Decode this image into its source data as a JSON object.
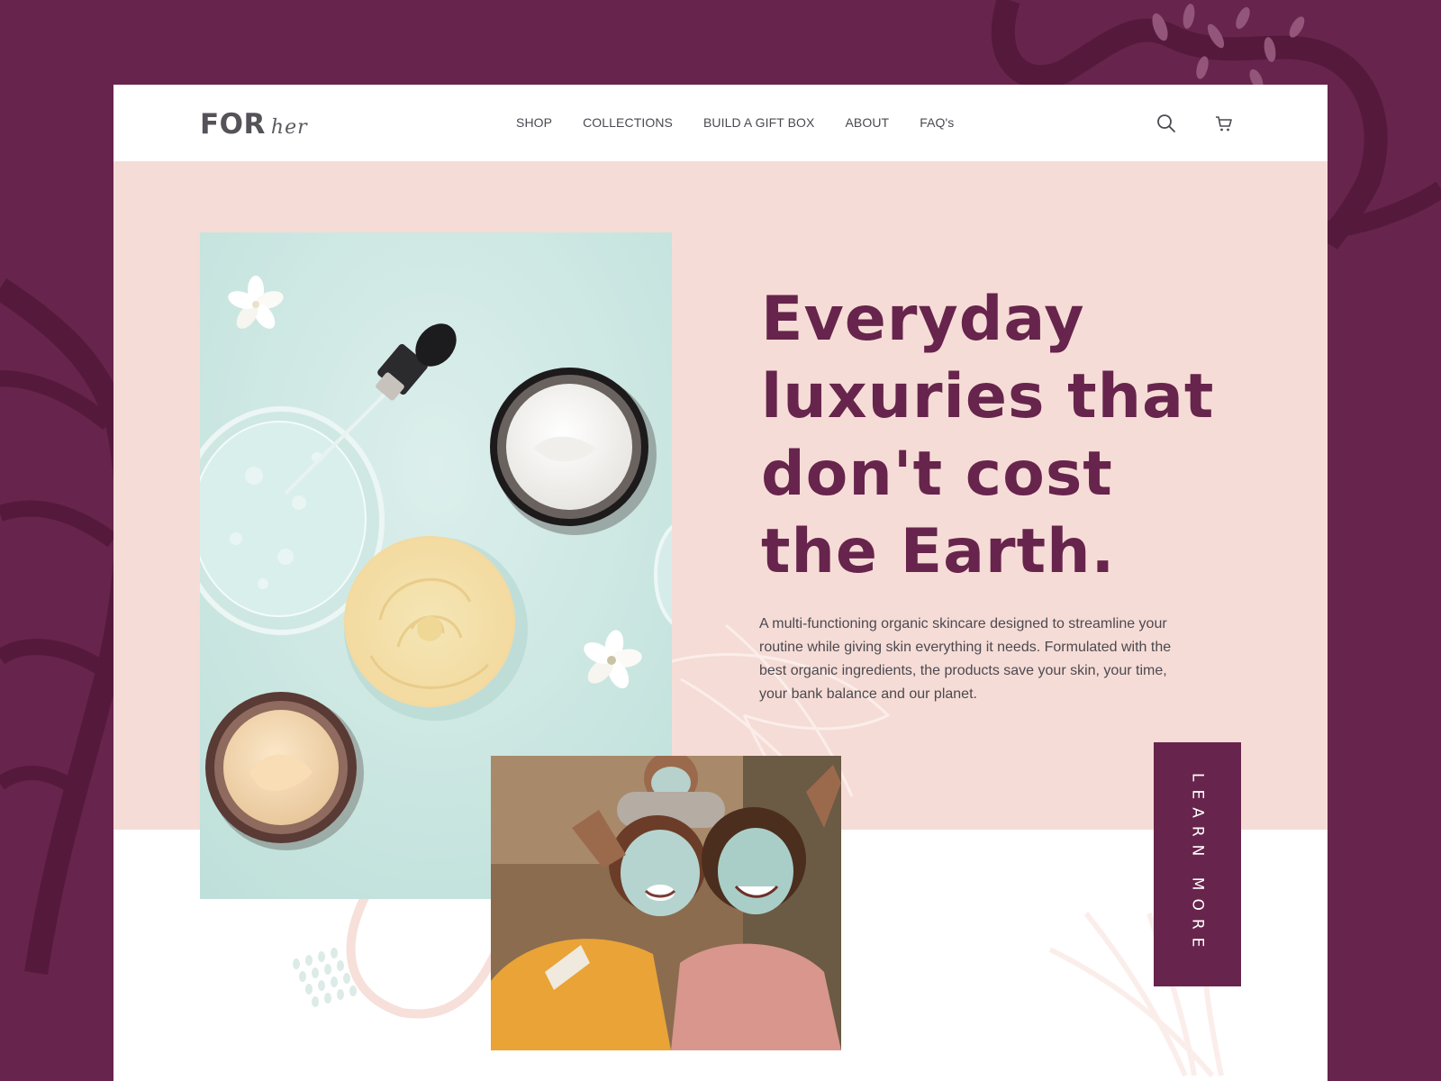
{
  "brand": {
    "logo_main": "FOR",
    "logo_script": "her"
  },
  "nav": {
    "items": [
      {
        "label": "SHOP"
      },
      {
        "label": "COLLECTIONS"
      },
      {
        "label": "BUILD A GIFT BOX"
      },
      {
        "label": "ABOUT"
      },
      {
        "label": "FAQ's"
      }
    ],
    "icons": [
      "search-icon",
      "cart-icon"
    ]
  },
  "hero": {
    "headline_lines": [
      "Everyday",
      "luxuries that",
      "don't cost",
      "the Earth."
    ],
    "description": "A multi-functioning organic skincare designed to streamline your routine while giving skin everything it needs. Formulated with the best organic ingredients, the products save your skin, your time, your bank balance and our planet.",
    "cta_label": "LEARN MORE"
  },
  "colors": {
    "brand_plum": "#67244c",
    "hero_pink": "#f6dcd6",
    "mint": "#d3ebe7",
    "text_gray": "#4b4950"
  }
}
